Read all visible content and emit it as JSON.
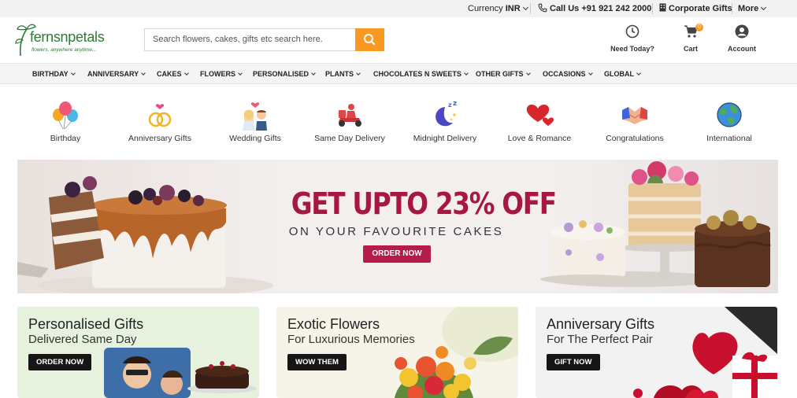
{
  "topbar": {
    "currency_label": "Currency",
    "currency_value": "INR",
    "call_label": "Call Us +91 921 242 2000",
    "corporate_label": "Corporate Gifts",
    "more_label": "More"
  },
  "logo": {
    "wordmark": "fernsnpetals",
    "tagline": "flowers, anywhere anytime..."
  },
  "search": {
    "placeholder": "Search flowers, cakes, gifts etc search here."
  },
  "header_actions": {
    "need_today": "Need Today?",
    "cart": "Cart",
    "cart_count": "0",
    "account": "Account"
  },
  "nav": {
    "items": [
      "BIRTHDAY",
      "ANNIVERSARY",
      "CAKES",
      "FLOWERS",
      "PERSONALISED",
      "PLANTS",
      "CHOCOLATES N SWEETS",
      "OTHER GIFTS",
      "OCCASIONS",
      "GLOBAL"
    ]
  },
  "occasions": [
    {
      "label": "Birthday",
      "icon": "balloons-icon"
    },
    {
      "label": "Anniversary Gifts",
      "icon": "rings-icon"
    },
    {
      "label": "Wedding Gifts",
      "icon": "couple-icon"
    },
    {
      "label": "Same Day Delivery",
      "icon": "scooter-icon"
    },
    {
      "label": "Midnight Delivery",
      "icon": "moon-icon"
    },
    {
      "label": "Love & Romance",
      "icon": "hearts-icon"
    },
    {
      "label": "Congratulations",
      "icon": "handshake-icon"
    },
    {
      "label": "International",
      "icon": "globe-icon"
    }
  ],
  "banner": {
    "headline": "GET UPTO 23% OFF",
    "subline": "ON YOUR FAVOURITE CAKES",
    "button": "ORDER NOW"
  },
  "cards": [
    {
      "title": "Personalised Gifts",
      "subtitle": "Delivered Same Day",
      "button": "ORDER NOW"
    },
    {
      "title": "Exotic Flowers",
      "subtitle": "For Luxurious Memories",
      "button": "WOW THEM"
    },
    {
      "title": "Anniversary Gifts",
      "subtitle": "For The Perfect Pair",
      "button": "GIFT NOW"
    }
  ],
  "colors": {
    "brand_green": "#2d7a34",
    "accent_orange": "#f89921",
    "promo_crimson": "#a8173f"
  }
}
